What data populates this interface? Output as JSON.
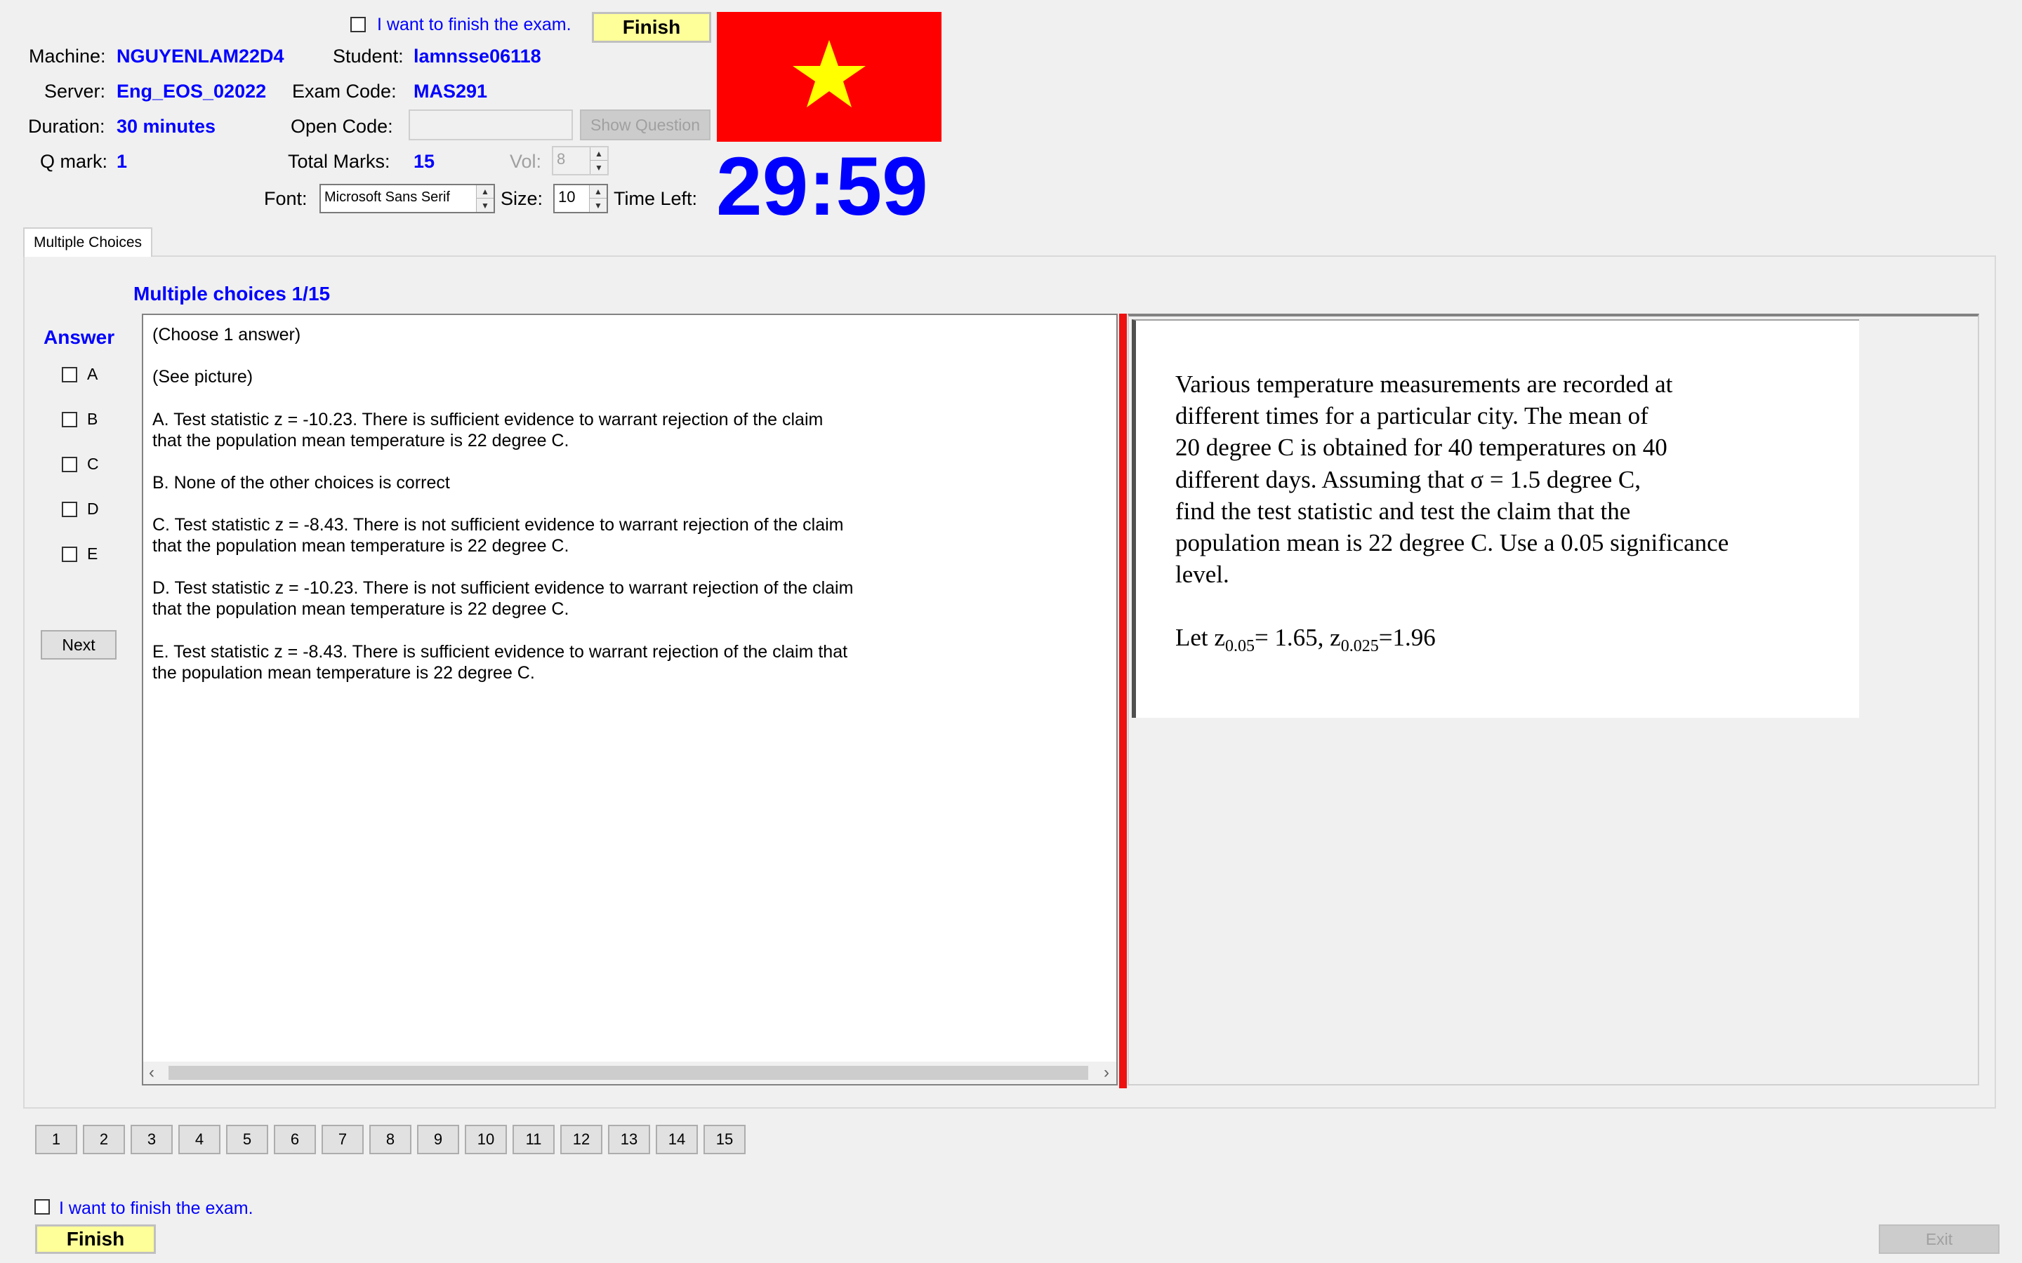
{
  "top": {
    "finish_check_label": "I want to finish the exam.",
    "finish_button": "Finish"
  },
  "info": {
    "machine_label": "Machine:",
    "machine": "NGUYENLAM22D4",
    "student_label": "Student:",
    "student": "lamnsse06118",
    "server_label": "Server:",
    "server": "Eng_EOS_02022",
    "exam_code_label": "Exam Code:",
    "exam_code": "MAS291",
    "duration_label": "Duration:",
    "duration": "30 minutes",
    "open_code_label": "Open Code:",
    "open_code_value": "",
    "show_question_button": "Show Question",
    "qmark_label": "Q mark:",
    "qmark": "1",
    "total_marks_label": "Total Marks:",
    "total_marks": "15",
    "vol_label": "Vol:",
    "vol": "8",
    "font_label": "Font:",
    "font_value": "Microsoft Sans Serif",
    "size_label": "Size:",
    "size_value": "10",
    "time_left_label": "Time Left:",
    "timer": "29:59"
  },
  "colors": {
    "flag_red": "#ff0000",
    "flag_star": "#ffff00",
    "accent_blue": "#0000ff",
    "splitter_red": "#ee1111",
    "finish_yellow": "#ffff99"
  },
  "tab": {
    "label": "Multiple Choices"
  },
  "question": {
    "title": "Multiple choices 1/15",
    "answer_label": "Answer",
    "options": [
      "A",
      "B",
      "C",
      "D",
      "E"
    ],
    "next_button": "Next",
    "lines": [
      "(Choose 1 answer)",
      "(See picture)",
      "A.  Test statistic z = -10.23. There is sufficient evidence to warrant rejection of the claim",
      "that the population mean temperature is 22 degree C.",
      "B.  None of the other choices is correct",
      "C.  Test statistic z = -8.43. There is not sufficient evidence to warrant rejection of the claim",
      "that the population mean temperature is 22 degree C.",
      "D.  Test statistic z = -10.23. There is not sufficient evidence to warrant rejection of the claim",
      "that the population mean temperature is 22 degree C.",
      "E.  Test statistic z = -8.43. There is sufficient evidence to warrant rejection of the claim that",
      "the population mean temperature is 22 degree C."
    ]
  },
  "picture": {
    "lines": [
      "Various temperature measurements are recorded at",
      "different times for a particular city. The mean of",
      "20 degree C is obtained for 40 temperatures on 40",
      "different days. Assuming that σ = 1.5 degree C,",
      "find the test statistic and test the claim that the",
      "population mean is 22 degree C. Use a 0.05 significance",
      "level."
    ],
    "given_prefix": "Let z",
    "z1_sub": "0.05",
    "z1_val": "= 1.65, z",
    "z2_sub": "0.025",
    "z2_val": "=1.96"
  },
  "nav_numbers": [
    "1",
    "2",
    "3",
    "4",
    "5",
    "6",
    "7",
    "8",
    "9",
    "10",
    "11",
    "12",
    "13",
    "14",
    "15"
  ],
  "bottom": {
    "finish_check_label": "I want to finish the exam.",
    "finish_button": "Finish",
    "exit_button": "Exit"
  }
}
